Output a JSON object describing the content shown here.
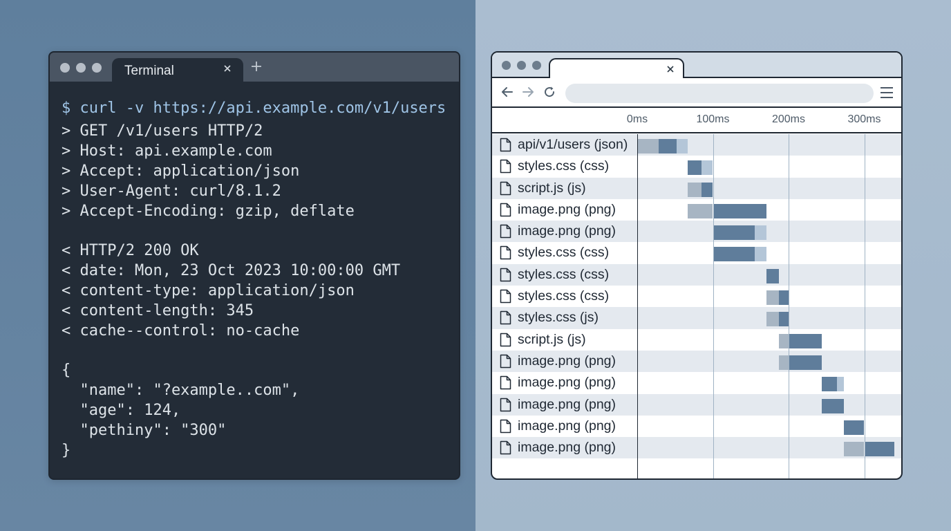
{
  "terminal": {
    "tab_title": "Terminal",
    "tab_close_icon": "close-icon",
    "new_tab_icon": "plus-icon",
    "prompt": "$ curl -v https://api.example.com/v1/users",
    "request_lines": [
      "> GET /v1/users HTTP/2",
      "> Host: api.example.com",
      "> Accept: application/json",
      "> User-Agent: curl/8.1.2",
      "> Accept-Encoding: gzip, deflate"
    ],
    "response_lines": [
      "< HTTP/2 200 OK",
      "< date: Mon, 23 Oct 2023 10:00:00 GMT",
      "< content-type: application/json",
      "< content-length: 345",
      "< cache--control: no-cache"
    ],
    "body_lines": [
      "{",
      "  \"name\": \"?example..com\",",
      "  \"age\": 124,",
      "  \"pethiny\": \"300\"",
      "}"
    ]
  },
  "browser": {
    "tab_close_icon": "close-icon",
    "back_icon": "arrow-left-icon",
    "forward_icon": "arrow-right-icon",
    "reload_icon": "reload-icon",
    "menu_icon": "hamburger-menu-icon",
    "address_value": "",
    "waterfall": {
      "ticks": [
        "0ms",
        "100ms",
        "200ms",
        "300ms"
      ],
      "tick_values": [
        0,
        100,
        200,
        300
      ],
      "max_ms": 350,
      "colors": {
        "wait": "#a7b5c3",
        "download": "#5f7d9b",
        "light": "#b4c6d8"
      },
      "rows": [
        {
          "label": "api/v1/users (json)",
          "segments": [
            {
              "start": 0,
              "end": 28,
              "kind": "wait"
            },
            {
              "start": 28,
              "end": 52,
              "kind": "download"
            },
            {
              "start": 52,
              "end": 67,
              "kind": "light"
            }
          ]
        },
        {
          "label": "styles.css (css)",
          "segments": [
            {
              "start": 67,
              "end": 85,
              "kind": "download"
            },
            {
              "start": 85,
              "end": 100,
              "kind": "light"
            }
          ]
        },
        {
          "label": "script.js (js)",
          "segments": [
            {
              "start": 67,
              "end": 85,
              "kind": "wait"
            },
            {
              "start": 85,
              "end": 100,
              "kind": "download"
            }
          ]
        },
        {
          "label": "image.png (png)",
          "segments": [
            {
              "start": 67,
              "end": 100,
              "kind": "wait"
            },
            {
              "start": 100,
              "end": 171,
              "kind": "download"
            }
          ]
        },
        {
          "label": "image.png (png)",
          "segments": [
            {
              "start": 100,
              "end": 155,
              "kind": "download"
            },
            {
              "start": 155,
              "end": 171,
              "kind": "light"
            }
          ]
        },
        {
          "label": "styles.css (css)",
          "segments": [
            {
              "start": 100,
              "end": 155,
              "kind": "download"
            },
            {
              "start": 155,
              "end": 171,
              "kind": "light"
            }
          ]
        },
        {
          "label": "styles.css (css)",
          "segments": [
            {
              "start": 171,
              "end": 187,
              "kind": "download"
            }
          ]
        },
        {
          "label": "styles.css (css)",
          "segments": [
            {
              "start": 171,
              "end": 187,
              "kind": "wait"
            },
            {
              "start": 187,
              "end": 200,
              "kind": "download"
            }
          ]
        },
        {
          "label": "styles.css (js)",
          "segments": [
            {
              "start": 171,
              "end": 187,
              "kind": "wait"
            },
            {
              "start": 187,
              "end": 200,
              "kind": "download"
            }
          ]
        },
        {
          "label": "script.js (js)",
          "segments": [
            {
              "start": 187,
              "end": 200,
              "kind": "wait"
            },
            {
              "start": 200,
              "end": 244,
              "kind": "download"
            }
          ]
        },
        {
          "label": "image.png (png)",
          "segments": [
            {
              "start": 187,
              "end": 200,
              "kind": "wait"
            },
            {
              "start": 200,
              "end": 244,
              "kind": "download"
            }
          ]
        },
        {
          "label": "image.png (png)",
          "segments": [
            {
              "start": 244,
              "end": 264,
              "kind": "download"
            },
            {
              "start": 264,
              "end": 273,
              "kind": "light"
            }
          ]
        },
        {
          "label": "image.png (png)",
          "segments": [
            {
              "start": 244,
              "end": 273,
              "kind": "download"
            }
          ]
        },
        {
          "label": "image.png (png)",
          "segments": [
            {
              "start": 273,
              "end": 300,
              "kind": "download"
            }
          ]
        },
        {
          "label": "image.png (png)",
          "segments": [
            {
              "start": 273,
              "end": 300,
              "kind": "wait"
            },
            {
              "start": 300,
              "end": 340,
              "kind": "download"
            }
          ]
        }
      ]
    }
  }
}
